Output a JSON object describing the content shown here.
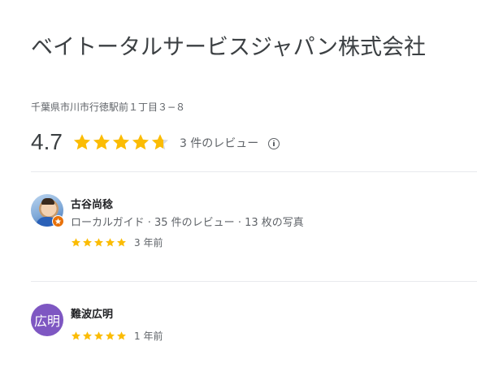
{
  "place": {
    "title": "ベイトータルサービスジャパン株式会社",
    "address": "千葉県市川市行徳駅前１丁目３−８",
    "rating": "4.7",
    "rating_value": 4.7,
    "review_count": "3 件のレビュー"
  },
  "colors": {
    "star": "#fbbc04",
    "star_empty": "#dadce0",
    "badge": "#e8710a",
    "avatar_letter_bg": "#7e57c2"
  },
  "reviews": [
    {
      "name": "古谷尚稔",
      "meta": "ローカルガイド · 35 件のレビュー · 13 枚の写真",
      "stars": 5,
      "time": "3 年前",
      "avatar": "photo"
    },
    {
      "name": "難波広明",
      "avatar_text": "広明",
      "stars": 5,
      "time": "1 年前",
      "avatar": "letter"
    }
  ],
  "icons": {
    "info": "info-icon",
    "star": "star-icon",
    "local_guide_badge": "local-guide-star-icon"
  }
}
